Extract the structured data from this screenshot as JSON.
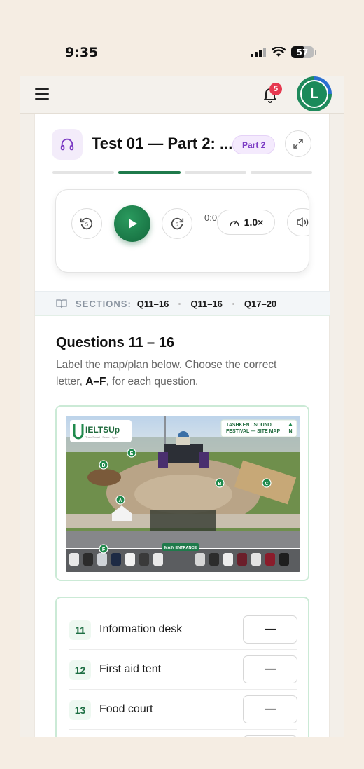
{
  "status_bar": {
    "time": "9:35",
    "battery": "57"
  },
  "topbar": {
    "notification_count": "5",
    "avatar_initial": "L"
  },
  "header": {
    "title": "Test 01 — Part 2: ...",
    "part_badge": "Part 2"
  },
  "progress": {
    "segments": 4,
    "active_index": 1
  },
  "player": {
    "rewind_seconds": "5",
    "forward_seconds": "5",
    "time": "0:0",
    "speed": "1.0×"
  },
  "sections": {
    "label": "SECTIONS:",
    "items": [
      "Q11–16",
      "Q11–16",
      "Q17–20"
    ]
  },
  "questions": {
    "heading": "Questions 11 – 16",
    "instruction_pre": "Label the map/plan below. Choose the correct letter,",
    "instruction_bold": "A–F",
    "instruction_post": ", for each question."
  },
  "map": {
    "logo_text": "IELTSUp",
    "logo_tagline": "Train Smart · Score Higher",
    "map_title_line1": "TASHKENT SOUND",
    "map_title_line2": "FESTIVAL — SITE MAP",
    "north": "N",
    "main_entrance": "MAIN ENTRANCE",
    "markers": [
      "A",
      "B",
      "C",
      "D",
      "E",
      "F"
    ]
  },
  "answers": [
    {
      "number": "11",
      "label": "Information desk",
      "value": "—"
    },
    {
      "number": "12",
      "label": "First aid tent",
      "value": "—"
    },
    {
      "number": "13",
      "label": "Food court",
      "value": "—"
    }
  ],
  "colors": {
    "accent_green": "#1f7a4b",
    "part_purple": "#7b3bc4",
    "badge_red": "#e63950"
  }
}
